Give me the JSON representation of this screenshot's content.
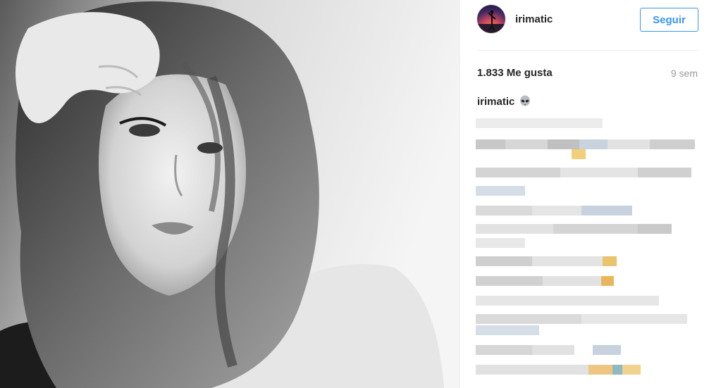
{
  "post": {
    "username": "irimatic",
    "follow_label": "Seguir",
    "likes": "1.833 Me gusta",
    "time_ago": "9 sem",
    "caption_user": "irimatic",
    "caption_emoji": "alien-icon"
  },
  "photo": {
    "description_icon": "portrait-photo"
  },
  "colors": {
    "accent": "#3897f0",
    "text": "#262626",
    "muted": "#999999"
  }
}
